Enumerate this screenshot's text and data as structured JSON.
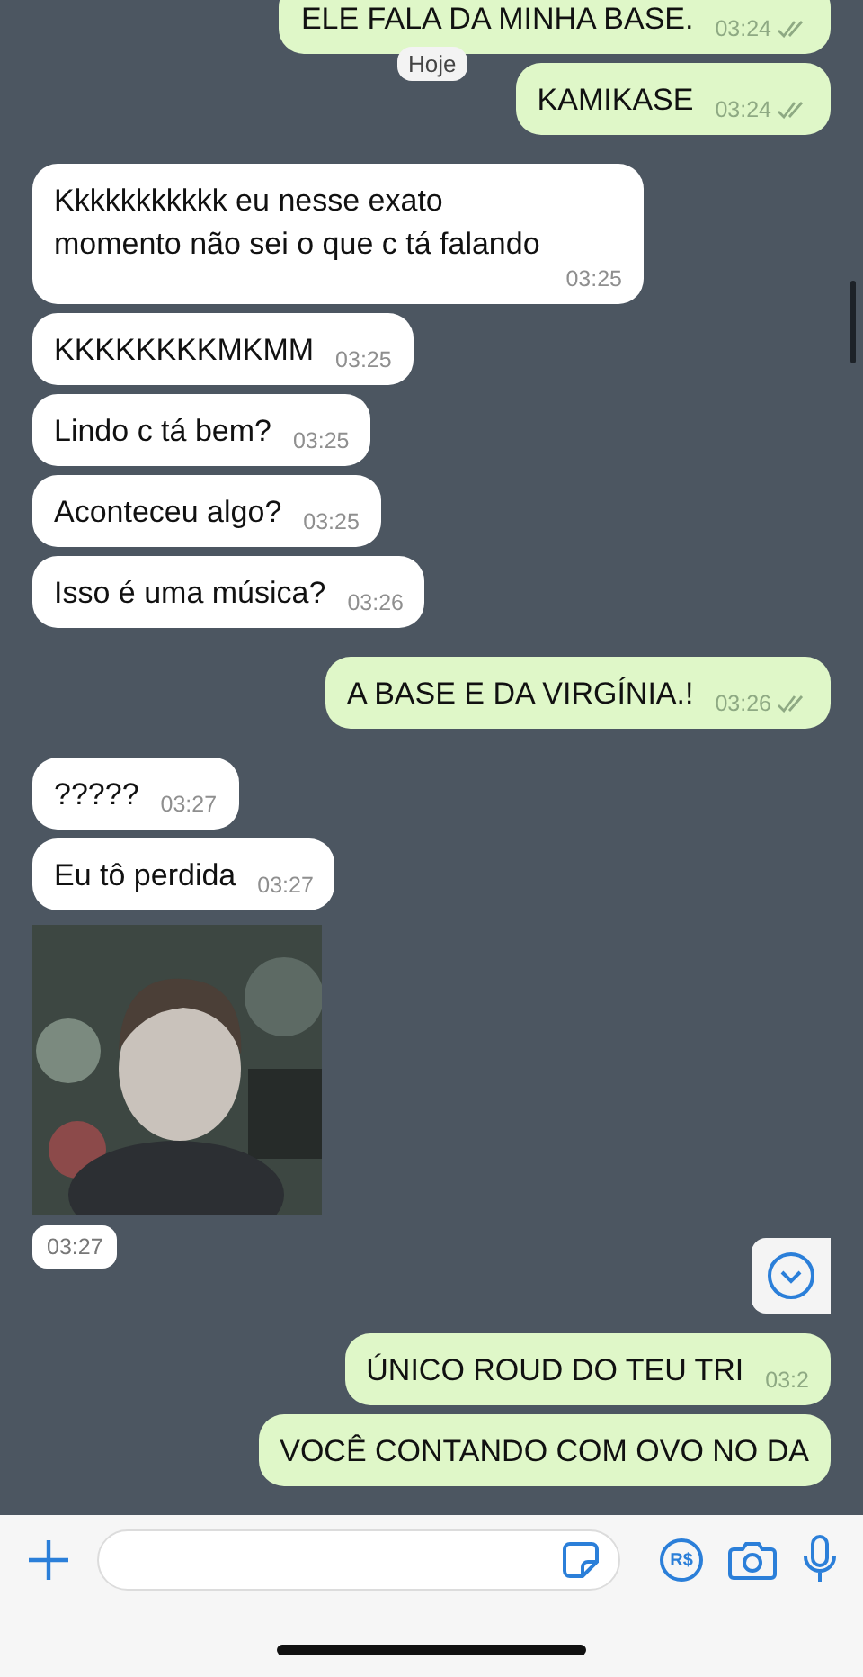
{
  "date_chip": "Hoje",
  "messages": [
    {
      "outgoing": true,
      "kind": "text",
      "text": "ELE FALA DA MINHA BASE.",
      "time": "03:24",
      "read": true
    },
    {
      "outgoing": true,
      "kind": "text",
      "text": "KAMIKASE",
      "time": "03:24",
      "read": true
    },
    {
      "outgoing": false,
      "kind": "text",
      "text": "Kkkkkkkkkkk eu nesse exato momento não sei o que c tá falando",
      "time": "03:25"
    },
    {
      "outgoing": false,
      "kind": "text",
      "text": "KKKKKKKKMKMM",
      "time": "03:25"
    },
    {
      "outgoing": false,
      "kind": "text",
      "text": "Lindo c tá bem?",
      "time": "03:25"
    },
    {
      "outgoing": false,
      "kind": "text",
      "text": "Aconteceu algo?",
      "time": "03:25"
    },
    {
      "outgoing": false,
      "kind": "text",
      "text": "Isso é uma música?",
      "time": "03:26"
    },
    {
      "outgoing": true,
      "kind": "text",
      "text": "A BASE E DA VIRGÍNIA.!",
      "time": "03:26",
      "read": true
    },
    {
      "outgoing": false,
      "kind": "text",
      "text": "?????",
      "time": "03:27"
    },
    {
      "outgoing": false,
      "kind": "text",
      "text": "Eu tô perdida",
      "time": "03:27"
    },
    {
      "outgoing": false,
      "time": "03:27"
    },
    {
      "outgoing": true,
      "kind": "text",
      "text": "ÚNICO ROUD DO TEU TRI",
      "time": "03:2"
    },
    {
      "outgoing": true,
      "kind": "text",
      "text": "VOCÊ CONTANDO COM OVO NO DA"
    }
  ],
  "composer": {
    "payment_label": "R$"
  }
}
